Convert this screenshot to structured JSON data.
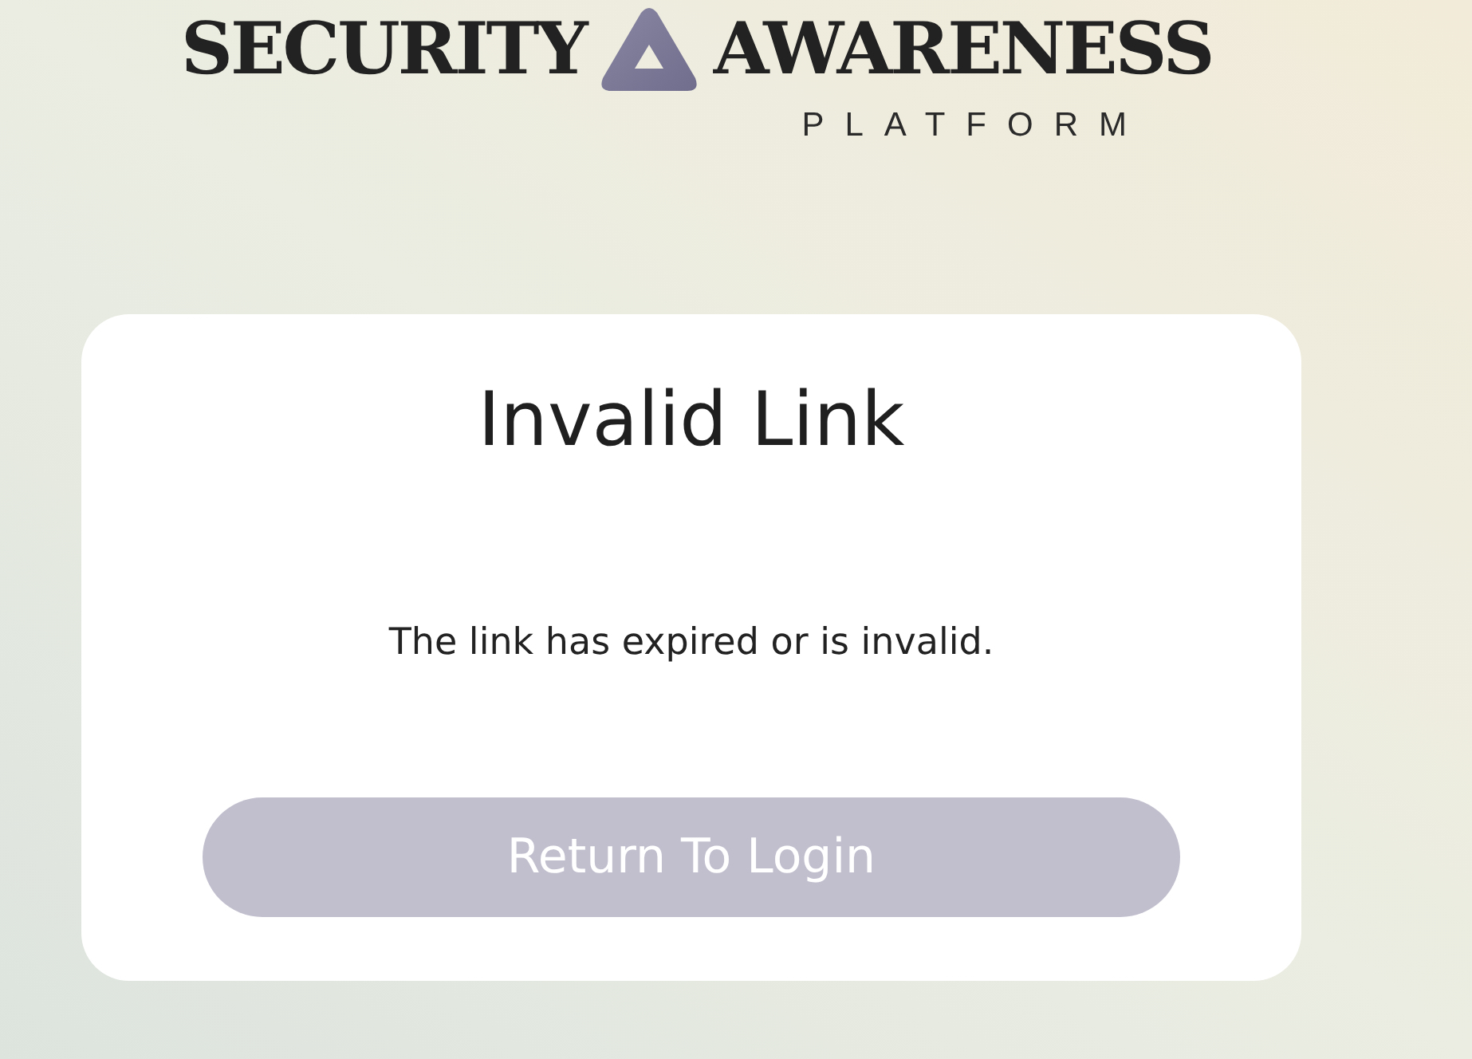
{
  "logo": {
    "words": [
      "SECURITY",
      "AWARENESS"
    ],
    "subtitle": "PLATFORM"
  },
  "card": {
    "title": "Invalid Link",
    "message": "The link has expired or is invalid.",
    "button": {
      "label": "Return To Login"
    }
  }
}
